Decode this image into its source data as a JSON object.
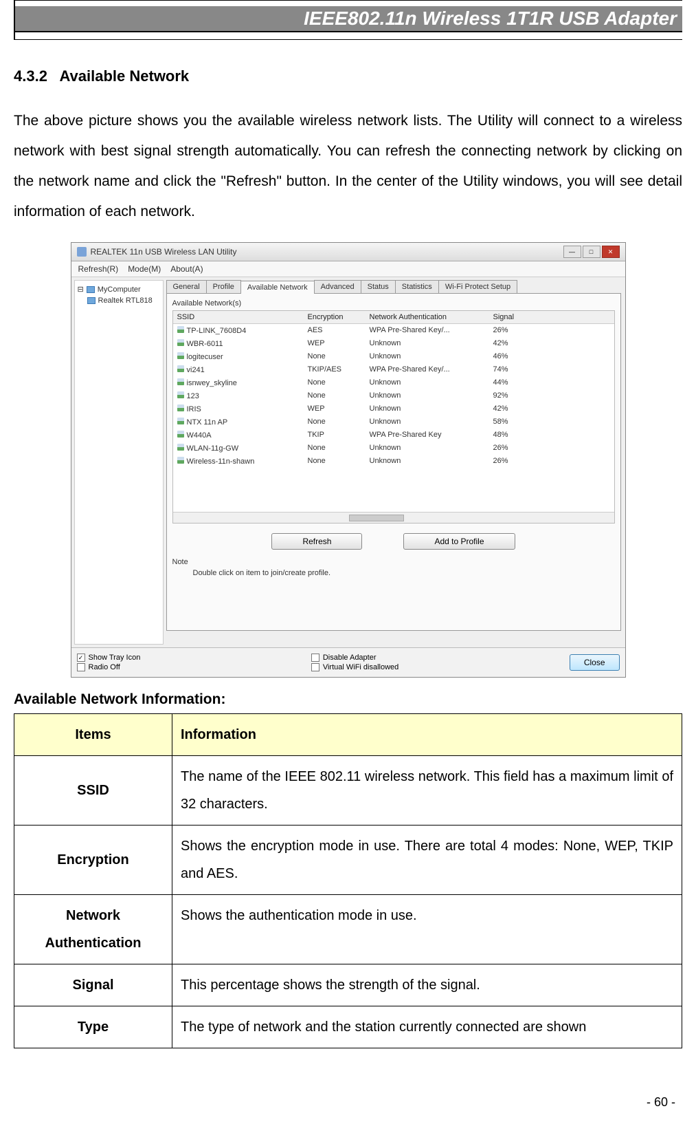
{
  "header": {
    "title": "IEEE802.11n Wireless 1T1R USB Adapter"
  },
  "section": {
    "number": "4.3.2",
    "title": "Available Network"
  },
  "paragraph": "The above picture shows you the available wireless network lists. The Utility will connect to a wireless network with best signal strength automatically. You can refresh the connecting network by clicking on the network name and click the \"Refresh\" button. In the center of the Utility windows, you will see detail information of each network.",
  "utility": {
    "window_title": "REALTEK 11n USB Wireless LAN Utility",
    "menubar": [
      "Refresh(R)",
      "Mode(M)",
      "About(A)"
    ],
    "tree": {
      "root": "MyComputer",
      "child": "Realtek RTL818"
    },
    "tabs": [
      "General",
      "Profile",
      "Available Network",
      "Advanced",
      "Status",
      "Statistics",
      "Wi-Fi Protect Setup"
    ],
    "active_tab_index": 2,
    "fieldset_label": "Available Network(s)",
    "columns": [
      "SSID",
      "Encryption",
      "Network Authentication",
      "Signal"
    ],
    "rows": [
      {
        "ssid": "TP-LINK_7608D4",
        "enc": "AES",
        "auth": "WPA Pre-Shared Key/...",
        "signal": "26%"
      },
      {
        "ssid": "WBR-6011",
        "enc": "WEP",
        "auth": "Unknown",
        "signal": "42%"
      },
      {
        "ssid": "logitecuser",
        "enc": "None",
        "auth": "Unknown",
        "signal": "46%"
      },
      {
        "ssid": "vi241",
        "enc": "TKIP/AES",
        "auth": "WPA Pre-Shared Key/...",
        "signal": "74%"
      },
      {
        "ssid": "isnwey_skyline",
        "enc": "None",
        "auth": "Unknown",
        "signal": "44%"
      },
      {
        "ssid": "123",
        "enc": "None",
        "auth": "Unknown",
        "signal": "92%"
      },
      {
        "ssid": "IRIS",
        "enc": "WEP",
        "auth": "Unknown",
        "signal": "42%"
      },
      {
        "ssid": "NTX 11n AP",
        "enc": "None",
        "auth": "Unknown",
        "signal": "58%"
      },
      {
        "ssid": "W440A",
        "enc": "TKIP",
        "auth": "WPA Pre-Shared Key",
        "signal": "48%"
      },
      {
        "ssid": "WLAN-11g-GW",
        "enc": "None",
        "auth": "Unknown",
        "signal": "26%"
      },
      {
        "ssid": "Wireless-11n-shawn",
        "enc": "None",
        "auth": "Unknown",
        "signal": "26%"
      }
    ],
    "buttons": {
      "refresh": "Refresh",
      "add_profile": "Add to Profile"
    },
    "note_label": "Note",
    "note_text": "Double click on item to join/create profile.",
    "bottom": {
      "show_tray": "Show Tray Icon",
      "radio_off": "Radio Off",
      "disable_adapter": "Disable Adapter",
      "virtual_wifi": "Virtual WiFi disallowed",
      "close": "Close"
    }
  },
  "info_heading": "Available Network Information:",
  "info_table": {
    "head_items": "Items",
    "head_info": "Information",
    "rows": [
      {
        "item": "SSID",
        "desc": "The name of the IEEE 802.11 wireless network. This field has a maximum limit of 32 characters."
      },
      {
        "item": "Encryption",
        "desc": "Shows the encryption mode in use. There are total 4 modes: None, WEP, TKIP and AES."
      },
      {
        "item": "Network Authentication",
        "desc": "Shows the authentication mode in use."
      },
      {
        "item": "Signal",
        "desc": "This percentage shows the strength of the signal."
      },
      {
        "item": "Type",
        "desc": "The type of network and the station currently connected are shown"
      }
    ]
  },
  "page_number": "- 60 -"
}
